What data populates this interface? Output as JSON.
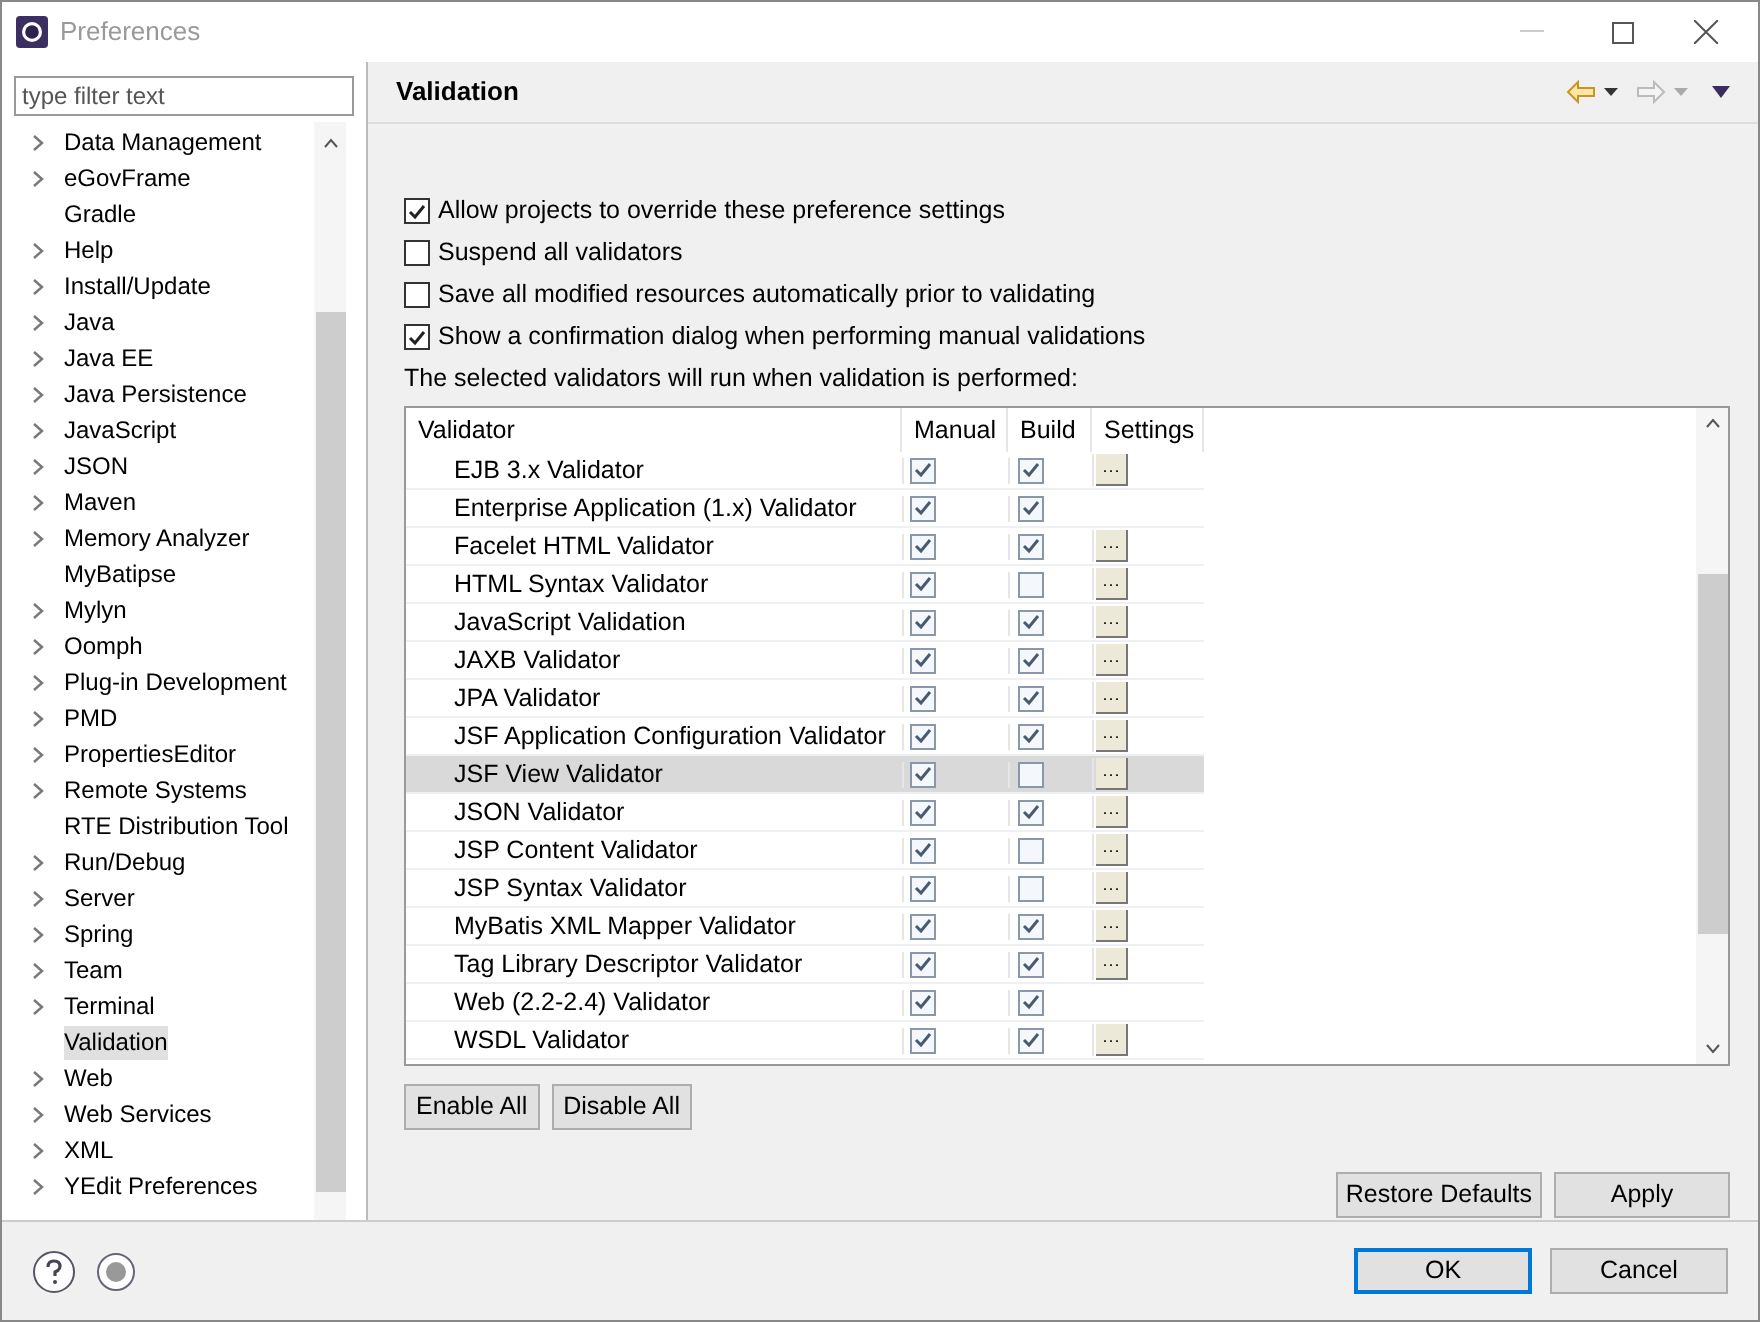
{
  "window": {
    "title": "Preferences"
  },
  "filter": {
    "placeholder": "type filter text"
  },
  "tree": [
    {
      "label": "Data Management",
      "expandable": true,
      "selected": false
    },
    {
      "label": "eGovFrame",
      "expandable": true,
      "selected": false
    },
    {
      "label": "Gradle",
      "expandable": false,
      "selected": false
    },
    {
      "label": "Help",
      "expandable": true,
      "selected": false
    },
    {
      "label": "Install/Update",
      "expandable": true,
      "selected": false
    },
    {
      "label": "Java",
      "expandable": true,
      "selected": false
    },
    {
      "label": "Java EE",
      "expandable": true,
      "selected": false
    },
    {
      "label": "Java Persistence",
      "expandable": true,
      "selected": false
    },
    {
      "label": "JavaScript",
      "expandable": true,
      "selected": false
    },
    {
      "label": "JSON",
      "expandable": true,
      "selected": false
    },
    {
      "label": "Maven",
      "expandable": true,
      "selected": false
    },
    {
      "label": "Memory Analyzer",
      "expandable": true,
      "selected": false
    },
    {
      "label": "MyBatipse",
      "expandable": false,
      "selected": false
    },
    {
      "label": "Mylyn",
      "expandable": true,
      "selected": false
    },
    {
      "label": "Oomph",
      "expandable": true,
      "selected": false
    },
    {
      "label": "Plug-in Development",
      "expandable": true,
      "selected": false
    },
    {
      "label": "PMD",
      "expandable": true,
      "selected": false
    },
    {
      "label": "PropertiesEditor",
      "expandable": true,
      "selected": false
    },
    {
      "label": "Remote Systems",
      "expandable": true,
      "selected": false
    },
    {
      "label": "RTE Distribution Tool",
      "expandable": false,
      "selected": false
    },
    {
      "label": "Run/Debug",
      "expandable": true,
      "selected": false
    },
    {
      "label": "Server",
      "expandable": true,
      "selected": false
    },
    {
      "label": "Spring",
      "expandable": true,
      "selected": false
    },
    {
      "label": "Team",
      "expandable": true,
      "selected": false
    },
    {
      "label": "Terminal",
      "expandable": true,
      "selected": false
    },
    {
      "label": "Validation",
      "expandable": false,
      "selected": true
    },
    {
      "label": "Web",
      "expandable": true,
      "selected": false
    },
    {
      "label": "Web Services",
      "expandable": true,
      "selected": false
    },
    {
      "label": "XML",
      "expandable": true,
      "selected": false
    },
    {
      "label": "YEdit Preferences",
      "expandable": true,
      "selected": false
    }
  ],
  "page": {
    "title": "Validation",
    "options": [
      {
        "label": "Allow projects to override these preference settings",
        "checked": true
      },
      {
        "label": "Suspend all validators",
        "checked": false
      },
      {
        "label": "Save all modified resources automatically prior to validating",
        "checked": false
      },
      {
        "label": "Show a confirmation dialog when performing manual validations",
        "checked": true
      }
    ],
    "note": "The selected validators will run when validation is performed:",
    "table": {
      "columns": [
        "Validator",
        "Manual",
        "Build",
        "Settings"
      ],
      "rows": [
        {
          "name": "EJB 3.x Validator",
          "manual": true,
          "build": true,
          "settings": true,
          "selected": false
        },
        {
          "name": "Enterprise Application (1.x) Validator",
          "manual": true,
          "build": true,
          "settings": false,
          "selected": false
        },
        {
          "name": "Facelet HTML Validator",
          "manual": true,
          "build": true,
          "settings": true,
          "selected": false
        },
        {
          "name": "HTML Syntax Validator",
          "manual": true,
          "build": false,
          "settings": true,
          "selected": false
        },
        {
          "name": "JavaScript Validation",
          "manual": true,
          "build": true,
          "settings": true,
          "selected": false
        },
        {
          "name": "JAXB Validator",
          "manual": true,
          "build": true,
          "settings": true,
          "selected": false
        },
        {
          "name": "JPA Validator",
          "manual": true,
          "build": true,
          "settings": true,
          "selected": false
        },
        {
          "name": "JSF Application Configuration Validator",
          "manual": true,
          "build": true,
          "settings": true,
          "selected": false
        },
        {
          "name": "JSF View Validator",
          "manual": true,
          "build": false,
          "settings": true,
          "selected": true
        },
        {
          "name": "JSON Validator",
          "manual": true,
          "build": true,
          "settings": true,
          "selected": false
        },
        {
          "name": "JSP Content Validator",
          "manual": true,
          "build": false,
          "settings": true,
          "selected": false
        },
        {
          "name": "JSP Syntax Validator",
          "manual": true,
          "build": false,
          "settings": true,
          "selected": false
        },
        {
          "name": "MyBatis XML Mapper Validator",
          "manual": true,
          "build": true,
          "settings": true,
          "selected": false
        },
        {
          "name": "Tag Library Descriptor Validator",
          "manual": true,
          "build": true,
          "settings": true,
          "selected": false
        },
        {
          "name": "Web (2.2-2.4) Validator",
          "manual": true,
          "build": true,
          "settings": false,
          "selected": false
        },
        {
          "name": "WSDL Validator",
          "manual": true,
          "build": true,
          "settings": true,
          "selected": false
        }
      ],
      "settings_label": "···"
    },
    "table_buttons": [
      "Enable All",
      "Disable All"
    ],
    "page_buttons": [
      "Restore Defaults",
      "Apply"
    ]
  },
  "dialog_buttons": [
    {
      "label": "OK",
      "default": true
    },
    {
      "label": "Cancel",
      "default": false
    }
  ]
}
